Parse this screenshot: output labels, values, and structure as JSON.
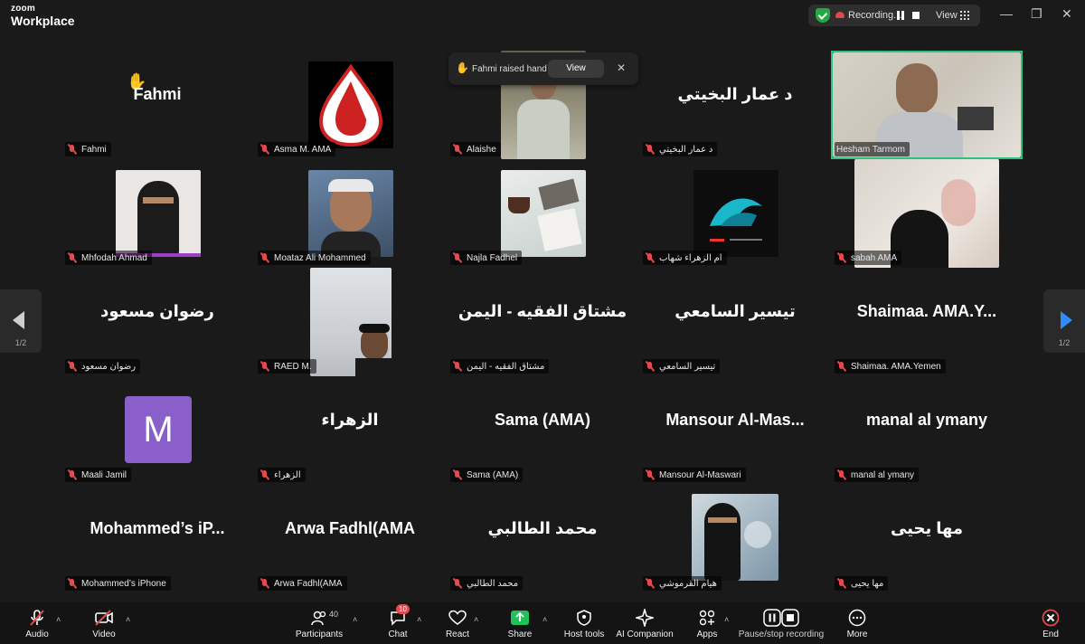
{
  "app": {
    "brand_top": "zoom",
    "brand_bottom": "Workplace"
  },
  "recording": {
    "status": "Recording...",
    "view_label": "View"
  },
  "window_controls": {
    "minimize": "—",
    "restore": "❐",
    "close": "✕"
  },
  "toast": {
    "icon": "✋",
    "text": "Fahmi raised hand",
    "button": "View",
    "close": "✕"
  },
  "pagination": {
    "left": "1/2",
    "right": "1/2"
  },
  "tiles": [
    {
      "big": "Fahmi",
      "label": "Fahmi",
      "hand": "✋"
    },
    {
      "big": "",
      "label": "Asma M. AMA"
    },
    {
      "big": "",
      "label": "Alaishe"
    },
    {
      "big": "د عمار البخيتي",
      "label": "د عمار البخيتي"
    },
    {
      "big": "",
      "label": "Hesham Tarmom"
    },
    {
      "big": "",
      "label": "Mhfodah Ahmad"
    },
    {
      "big": "",
      "label": "Moataz Ali Mohammed"
    },
    {
      "big": "",
      "label": "Najla Fadhel"
    },
    {
      "big": "",
      "label": "ام الزهراء شهاب"
    },
    {
      "big": "",
      "label": "sabah AMA"
    },
    {
      "big": "رضوان مسعود",
      "label": "رضوان مسعود"
    },
    {
      "big": "",
      "label": "RAED M."
    },
    {
      "big": "مشتاق الفقيه - اليمن",
      "label": "مشتاق الفقيه - اليمن"
    },
    {
      "big": "تيسير السامعي",
      "label": "تيسير السامعي"
    },
    {
      "big": "Shaimaa. AMA.Y...",
      "label": "Shaimaa. AMA.Yemen"
    },
    {
      "big": "",
      "label": "Maali Jamil",
      "avatar": "M"
    },
    {
      "big": "الزهراء",
      "label": "الزهراء"
    },
    {
      "big": "Sama (AMA)",
      "label": "Sama (AMA)"
    },
    {
      "big": "Mansour  Al-Mas...",
      "label": "Mansour Al-Maswari"
    },
    {
      "big": "manal al ymany",
      "label": "manal al ymany"
    },
    {
      "big": "Mohammed’s  iP...",
      "label": "Mohammed’s iPhone"
    },
    {
      "big": "Arwa Fadhl(AMA",
      "label": "Arwa Fadhl(AMA"
    },
    {
      "big": "محمد الطالبي",
      "label": "محمد الطالبي"
    },
    {
      "big": "",
      "label": "هيام القرموشي"
    },
    {
      "big": "مها يحيى",
      "label": "مها يحيى"
    }
  ],
  "toolbar": {
    "audio": "Audio",
    "video": "Video",
    "participants": "Participants",
    "participants_count": "40",
    "chat": "Chat",
    "chat_badge": "10",
    "react": "React",
    "share": "Share",
    "host_tools": "Host tools",
    "ai_companion": "AI Companion",
    "apps": "Apps",
    "pause_stop": "Pause/stop recording",
    "more": "More",
    "end": "End"
  },
  "colors": {
    "accent": "#2d8cff",
    "active_border": "#2ec27e",
    "muted": "#e5484d",
    "avatar_purple": "#8b5fc9",
    "share_green": "#23c15a"
  }
}
